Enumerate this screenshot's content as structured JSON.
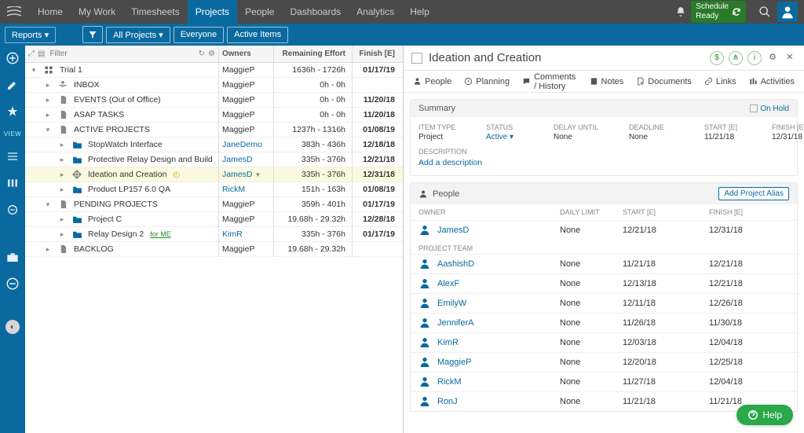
{
  "topnav": {
    "items": [
      "Home",
      "My Work",
      "Timesheets",
      "Projects",
      "People",
      "Dashboards",
      "Analytics",
      "Help"
    ],
    "active_index": 3,
    "schedule_label_line1": "Schedule",
    "schedule_label_line2": "Ready"
  },
  "subbar": {
    "reports_label": "Reports ▾",
    "chips": [
      "All Projects ▾",
      "Everyone",
      "Active Items"
    ]
  },
  "columns": {
    "owners": "Owners",
    "effort": "Remaining Effort",
    "finish": "Finish [E]",
    "filter_placeholder": "Filter"
  },
  "tree": [
    {
      "depth": 0,
      "exp": "−",
      "icon": "grid",
      "name": "Trial 1",
      "owner": "MaggieP",
      "owner_link": false,
      "effort": "1636h - 1726h",
      "finish": "01/17/19",
      "finish_bold": true
    },
    {
      "depth": 1,
      "exp": "+",
      "icon": "inbox",
      "name": "INBOX",
      "owner": "MaggieP",
      "owner_link": false,
      "effort": "0h - 0h",
      "finish": ""
    },
    {
      "depth": 1,
      "exp": "+",
      "icon": "doc",
      "name": "EVENTS (Out of Office)",
      "owner": "MaggieP",
      "owner_link": false,
      "effort": "0h - 0h",
      "finish": "11/20/18",
      "finish_bold": true
    },
    {
      "depth": 1,
      "exp": "+",
      "icon": "doc",
      "name": "ASAP TASKS",
      "owner": "MaggieP",
      "owner_link": false,
      "effort": "0h - 0h",
      "finish": "11/20/18",
      "finish_bold": true
    },
    {
      "depth": 1,
      "exp": "−",
      "icon": "doc",
      "name": "ACTIVE PROJECTS",
      "owner": "MaggieP",
      "owner_link": false,
      "effort": "1237h - 1316h",
      "finish": "01/08/19",
      "finish_bold": true
    },
    {
      "depth": 2,
      "exp": "+",
      "icon": "folder",
      "name": "StopWatch Interface",
      "owner": "JaneDemo",
      "owner_link": true,
      "effort": "383h - 436h",
      "finish": "12/18/18",
      "finish_bold": true
    },
    {
      "depth": 2,
      "exp": "+",
      "icon": "folder",
      "name": "Protective Relay Design and Build",
      "owner": "JamesD",
      "owner_link": true,
      "effort": "335h - 376h",
      "finish": "12/21/18",
      "finish_bold": true
    },
    {
      "depth": 2,
      "exp": "+",
      "icon": "move",
      "name": "Ideation and Creation",
      "owner": "JamesD",
      "owner_link": true,
      "owner_caret": true,
      "effort": "335h - 376h",
      "finish": "12/31/18",
      "finish_bold": true,
      "selected": true,
      "spinner": true
    },
    {
      "depth": 2,
      "exp": "+",
      "icon": "folder",
      "name": "Product LP157 6.0 QA",
      "owner": "RickM",
      "owner_link": true,
      "effort": "151h - 163h",
      "finish": "01/08/19",
      "finish_bold": true
    },
    {
      "depth": 1,
      "exp": "−",
      "icon": "doc",
      "name": "PENDING PROJECTS",
      "owner": "MaggieP",
      "owner_link": false,
      "effort": "359h - 401h",
      "finish": "01/17/19",
      "finish_bold": true
    },
    {
      "depth": 2,
      "exp": "+",
      "icon": "folder",
      "name": "Project C",
      "owner": "MaggieP",
      "owner_link": false,
      "effort": "19.68h - 29.32h",
      "finish": "12/28/18",
      "finish_bold": true
    },
    {
      "depth": 2,
      "exp": "+",
      "icon": "folder",
      "name": "Relay Design 2",
      "for_me": "for ME",
      "owner": "KimR",
      "owner_link": true,
      "effort": "335h - 376h",
      "finish": "01/17/19",
      "finish_bold": true
    },
    {
      "depth": 1,
      "exp": "+",
      "icon": "doc",
      "name": "BACKLOG",
      "owner": "MaggieP",
      "owner_link": false,
      "effort": "19.68h - 29.32h",
      "finish": ""
    }
  ],
  "detail": {
    "title": "Ideation and Creation",
    "tabs": [
      "People",
      "Planning",
      "Comments / History",
      "Notes",
      "Documents",
      "Links",
      "Activities"
    ],
    "summary_label": "Summary",
    "onhold_label": "On Hold",
    "fields": {
      "item_type_lbl": "ITEM TYPE",
      "item_type": "Project",
      "status_lbl": "STATUS",
      "status": "Active ▾",
      "delay_lbl": "DELAY UNTIL",
      "delay": "None",
      "deadline_lbl": "DEADLINE",
      "deadline": "None",
      "start_lbl": "START [E]",
      "start": "11/21/18",
      "finish_lbl": "FINISH [E]",
      "finish": "12/31/18"
    },
    "desc_lbl": "DESCRIPTION",
    "add_desc": "Add a description",
    "people_label": "People",
    "add_alias": "Add Project Alias",
    "people_cols": {
      "owner": "OWNER",
      "daily": "DAILY LIMIT",
      "start": "START [E]",
      "finish": "FINISH [E]"
    },
    "owner_row": {
      "name": "JamesD",
      "daily": "None",
      "start": "12/21/18",
      "finish": "12/31/18"
    },
    "team_label": "PROJECT TEAM",
    "team": [
      {
        "name": "AashishD",
        "daily": "None",
        "start": "11/21/18",
        "finish": "12/21/18"
      },
      {
        "name": "AlexF",
        "daily": "None",
        "start": "12/13/18",
        "finish": "12/21/18"
      },
      {
        "name": "EmilyW",
        "daily": "None",
        "start": "12/11/18",
        "finish": "12/26/18"
      },
      {
        "name": "JenniferA",
        "daily": "None",
        "start": "11/26/18",
        "finish": "11/30/18"
      },
      {
        "name": "KimR",
        "daily": "None",
        "start": "12/03/18",
        "finish": "12/04/18"
      },
      {
        "name": "MaggieP",
        "daily": "None",
        "start": "12/20/18",
        "finish": "12/25/18"
      },
      {
        "name": "RickM",
        "daily": "None",
        "start": "11/27/18",
        "finish": "12/04/18"
      },
      {
        "name": "RonJ",
        "daily": "None",
        "start": "11/21/18",
        "finish": "11/21/18"
      }
    ]
  },
  "help_label": "Help",
  "rail_view_label": "VIEW"
}
